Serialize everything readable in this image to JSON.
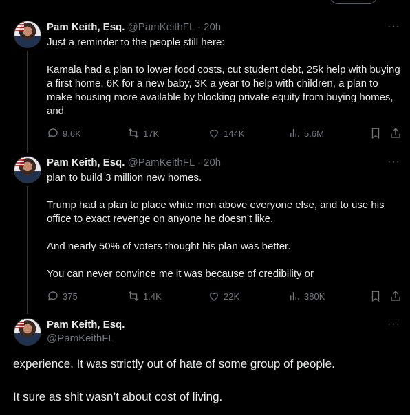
{
  "tweets": [
    {
      "name": "Pam Keith, Esq.",
      "handle": "@PamKeithFL",
      "time": "· 20h",
      "paragraphs": [
        "Just a reminder to the people still here:",
        "Kamala had a plan to lower food costs, cut student debt, 25k help with buying a first home, 6K for a new baby, 3K a year to help with children, a plan to make housing more available by blocking private equity from buying homes, and"
      ],
      "replies": "9.6K",
      "reposts": "17K",
      "likes": "144K",
      "views": "5.6M"
    },
    {
      "name": "Pam Keith, Esq.",
      "handle": "@PamKeithFL",
      "time": "· 20h",
      "paragraphs": [
        "plan to build 3 million new homes.",
        "Trump had a plan to place white men above everyone else, and to use his office to exact revenge on anyone he doesn’t like.",
        "And nearly 50% of voters thought his plan was better.",
        "You can never convince me it was because of credibility or"
      ],
      "replies": "375",
      "reposts": "1.4K",
      "likes": "22K",
      "views": "380K"
    }
  ],
  "main_tweet": {
    "name": "Pam Keith, Esq.",
    "handle": "@PamKeithFL",
    "paragraphs": [
      "experience.  It was strictly out of hate of some group of people.",
      "It sure as shit wasn’t about cost of living."
    ]
  },
  "more_label": "···"
}
